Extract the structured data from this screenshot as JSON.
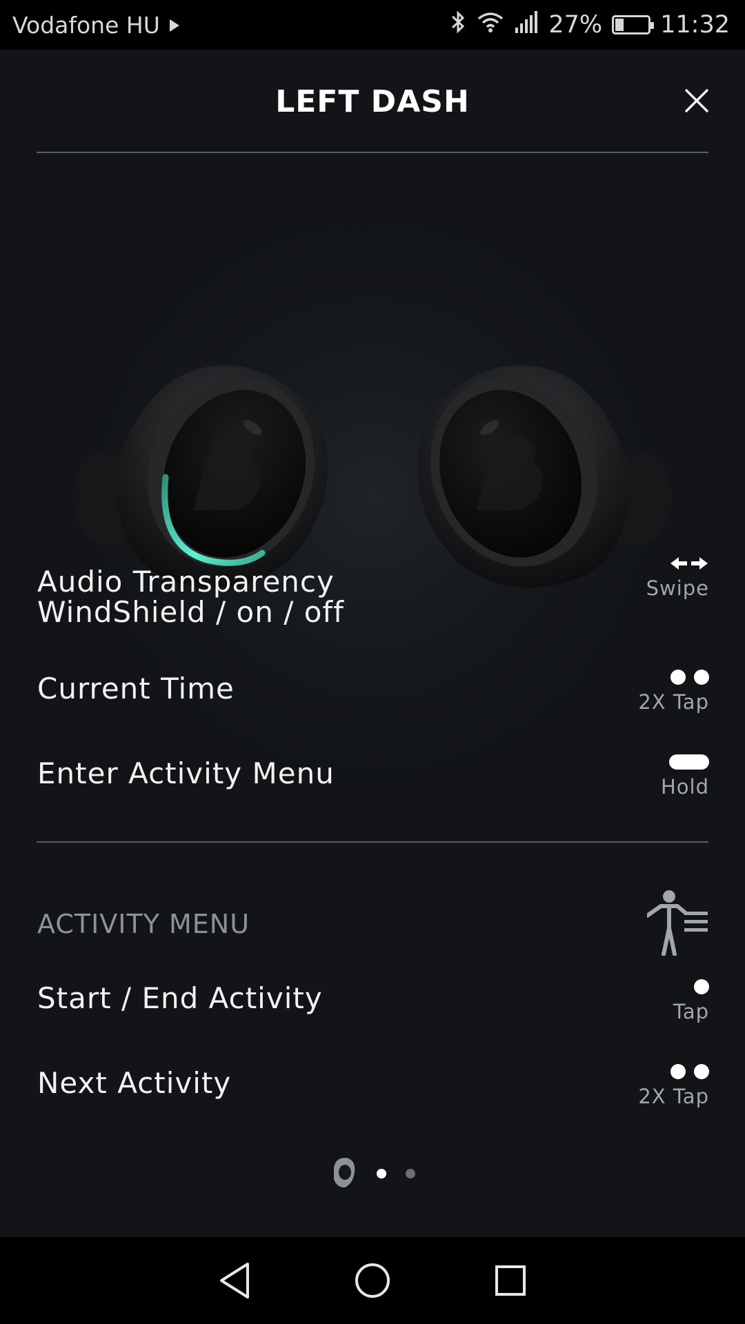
{
  "status_bar": {
    "carrier": "Vodafone HU",
    "battery": "27%",
    "battery_level": 0.27,
    "time": "11:32",
    "icons": [
      "play-icon",
      "bluetooth-icon",
      "wifi-icon",
      "signal-icon",
      "battery-icon"
    ]
  },
  "header": {
    "title": "LEFT DASH",
    "close_icon": "close-icon"
  },
  "controls": [
    {
      "label": "Audio Transparency\nWindShield / on / off",
      "label_line1": "Audio Transparency",
      "label_line2": "WindShield / on / off",
      "gesture": "Swipe",
      "gesture_icon": "swipe-arrows-icon"
    },
    {
      "label": "Current Time",
      "gesture": "2X Tap",
      "gesture_icon": "double-tap-icon"
    },
    {
      "label": "Enter Activity Menu",
      "gesture": "Hold",
      "gesture_icon": "hold-icon"
    }
  ],
  "activity_menu": {
    "heading": "ACTIVITY MENU",
    "icon": "person-menu-icon",
    "items": [
      {
        "label": "Start / End Activity",
        "gesture": "Tap",
        "gesture_icon": "tap-icon"
      },
      {
        "label": "Next Activity",
        "gesture": "2X Tap",
        "gesture_icon": "double-tap-icon"
      }
    ]
  },
  "pager": {
    "pages": 3,
    "active_index": 1
  },
  "nav_bar": {
    "icons": [
      "back-icon",
      "home-icon",
      "recents-icon"
    ]
  },
  "colors": {
    "background": "#15181c",
    "accent_glow": "#3fd3b3",
    "text_primary": "#f2f2f2",
    "text_secondary": "#a3a6aa"
  }
}
